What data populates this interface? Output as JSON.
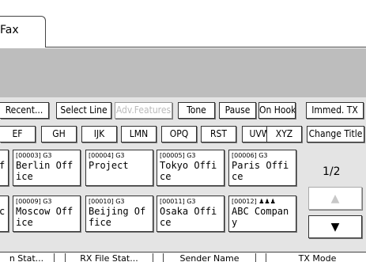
{
  "tab": {
    "label": "Fax"
  },
  "toolbar": {
    "recent": "Recent...",
    "select_line": "Select Line",
    "adv_features": "Adv.Features",
    "tone": "Tone",
    "pause": "Pause",
    "on_hook": "On Hook",
    "immed_tx": "Immed. TX"
  },
  "title_tabs": [
    "EF",
    "GH",
    "IJK",
    "LMN",
    "OPQ",
    "RST",
    "UVW",
    "XYZ"
  ],
  "change_title": "Change Title",
  "destinations": [
    {
      "header": "[00003] G3",
      "line1": "Berlin Off",
      "line2": "ice"
    },
    {
      "header": "[00004] G3",
      "line1": "Project",
      "line2": ""
    },
    {
      "header": "[00005] G3",
      "line1": "Tokyo Offi",
      "line2": "ce"
    },
    {
      "header": "[00006] G3",
      "line1": "Paris Offi",
      "line2": "ce"
    },
    {
      "header": "[00009] G3",
      "line1": "Moscow Off",
      "line2": "ice"
    },
    {
      "header": "[00010] G3",
      "line1": "Beijing Of",
      "line2": "fice"
    },
    {
      "header": "[00011] G3",
      "line1": "Osaka Offi",
      "line2": "ce"
    },
    {
      "header": "[00012] ♟♟♟",
      "line1": "ABC Compan",
      "line2": "y"
    }
  ],
  "left_cut": {
    "row1": "f",
    "row2": "c"
  },
  "page_indicator": "1/2",
  "scroll": {
    "up": "▲",
    "down": "▼"
  },
  "bottom_tabs": [
    "n Stat...",
    "RX File Stat...",
    "Sender Name",
    "TX Mode"
  ]
}
